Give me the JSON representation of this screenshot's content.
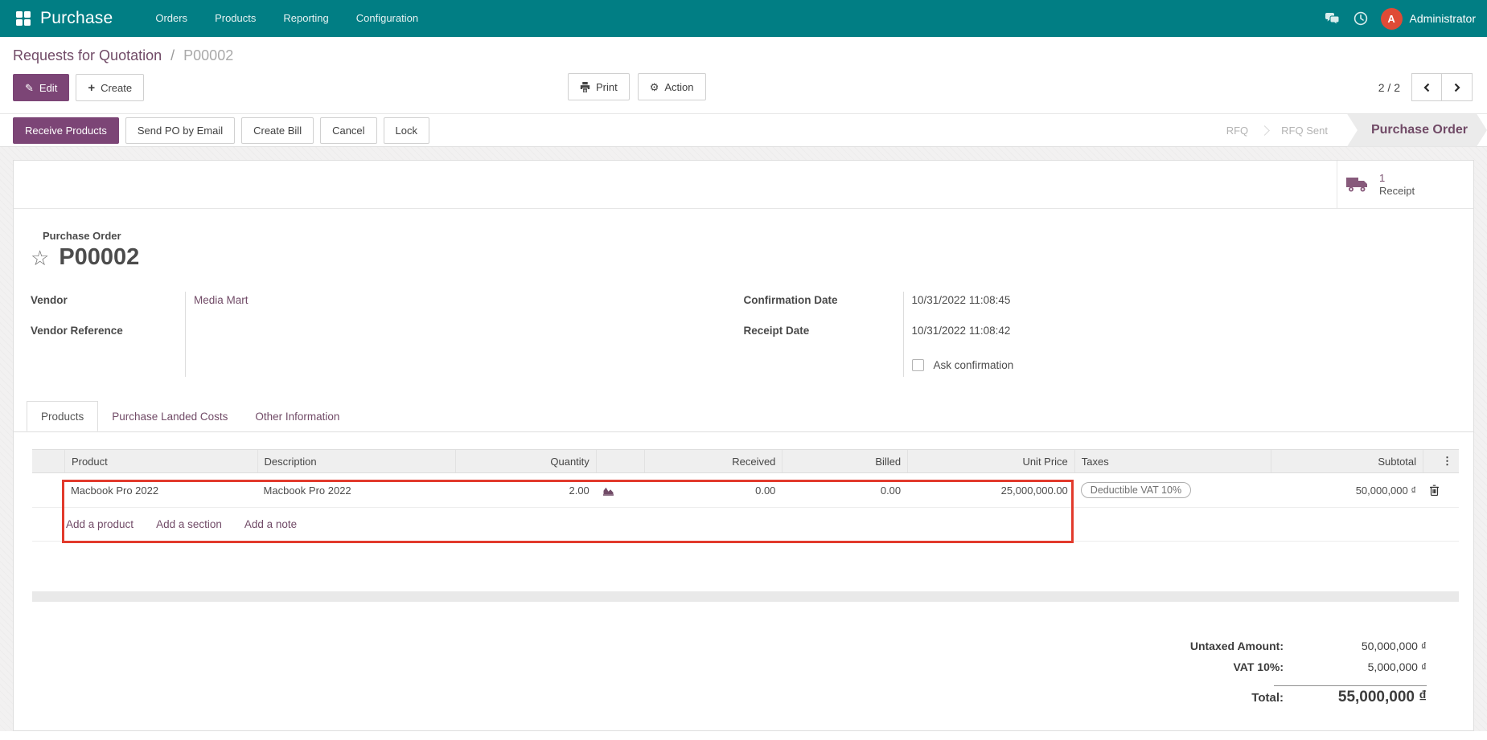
{
  "nav": {
    "brand": "Purchase",
    "items": [
      {
        "label": "Orders"
      },
      {
        "label": "Products"
      },
      {
        "label": "Reporting"
      },
      {
        "label": "Configuration"
      }
    ],
    "user": "Administrator",
    "avatar_letter": "A"
  },
  "breadcrumb": {
    "parent": "Requests for Quotation",
    "separator": "/",
    "current": "P00002"
  },
  "control": {
    "edit": "Edit",
    "create": "Create",
    "print": "Print",
    "action": "Action",
    "pager_value": "2 / 2"
  },
  "status_buttons": {
    "receive": "Receive Products",
    "send": "Send PO by Email",
    "create_bill": "Create Bill",
    "cancel": "Cancel",
    "lock": "Lock"
  },
  "statusbar": {
    "steps": [
      {
        "label": "RFQ"
      },
      {
        "label": "RFQ Sent"
      },
      {
        "label": "Purchase Order"
      }
    ]
  },
  "smart_button": {
    "count": "1",
    "label": "Receipt"
  },
  "form": {
    "title_label": "Purchase Order",
    "title": "P00002",
    "vendor_label": "Vendor",
    "vendor_value": "Media Mart",
    "vendor_ref_label": "Vendor Reference",
    "confirmation_date_label": "Confirmation Date",
    "confirmation_date_value": "10/31/2022 11:08:45",
    "receipt_date_label": "Receipt Date",
    "receipt_date_value": "10/31/2022 11:08:42",
    "ask_confirmation_label": "Ask confirmation"
  },
  "tabs": [
    {
      "label": "Products"
    },
    {
      "label": "Purchase Landed Costs"
    },
    {
      "label": "Other Information"
    }
  ],
  "table": {
    "headers": {
      "product": "Product",
      "description": "Description",
      "quantity": "Quantity",
      "received": "Received",
      "billed": "Billed",
      "unit_price": "Unit Price",
      "taxes": "Taxes",
      "subtotal": "Subtotal",
      "options": "⋮"
    },
    "row": {
      "product": "Macbook Pro 2022",
      "description": "Macbook Pro 2022",
      "quantity": "2.00",
      "received": "0.00",
      "billed": "0.00",
      "unit_price": "25,000,000.00",
      "tax_tag": "Deductible VAT 10%",
      "subtotal": "50,000,000 ₫"
    },
    "links": {
      "add_product": "Add a product",
      "add_section": "Add a section",
      "add_note": "Add a note"
    }
  },
  "totals": {
    "untaxed_label": "Untaxed Amount:",
    "untaxed_value": "50,000,000 ₫",
    "vat_label": "VAT 10%:",
    "vat_value": "5,000,000 ₫",
    "total_label": "Total:",
    "total_value": "55,000,000 ₫"
  },
  "icons": {
    "pencil": "✎",
    "plus": "+",
    "gear": "⚙",
    "star": "☆",
    "dots": "⋮"
  },
  "colors": {
    "nav-bg": "#017e84",
    "primary": "#7c4576",
    "link": "#714b67",
    "annotation": "#e23a2c",
    "avatar-bg": "#df4b36"
  }
}
